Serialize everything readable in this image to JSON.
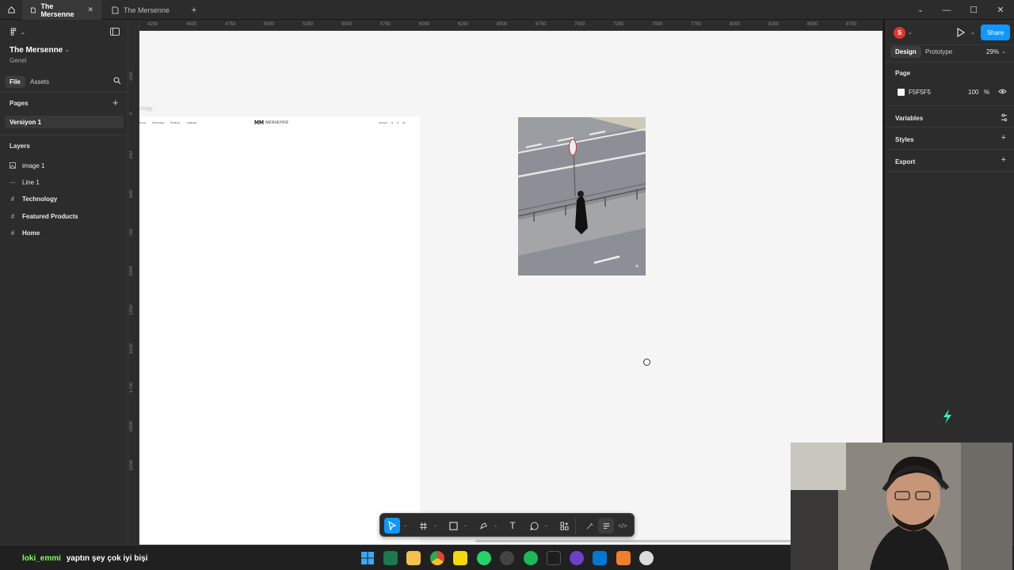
{
  "tabs": [
    {
      "label": "The Mersenne",
      "active": true
    },
    {
      "label": "The Mersenne",
      "active": false
    }
  ],
  "left_panel": {
    "project_name": "The Mersenne",
    "team": "Genel",
    "tab_file": "File",
    "tab_assets": "Assets",
    "pages_title": "Pages",
    "pages": [
      "Versiyon 1"
    ],
    "layers_title": "Layers",
    "layers": [
      {
        "label": "image 1",
        "icon": "image-icon"
      },
      {
        "label": "Line 1",
        "icon": "line-icon"
      },
      {
        "label": "Technology",
        "icon": "frame-icon"
      },
      {
        "label": "Featured Products",
        "icon": "frame-icon"
      },
      {
        "label": "Home",
        "icon": "frame-icon"
      }
    ]
  },
  "ruler_top": [
    "4250",
    "4500",
    "4750",
    "5000",
    "5250",
    "5500",
    "5750",
    "6000",
    "6250",
    "6500",
    "6750",
    "7000",
    "7250",
    "7500",
    "7750",
    "8000",
    "8250",
    "8500",
    "8750"
  ],
  "ruler_left": [
    "-250",
    "0",
    "250",
    "500",
    "750",
    "1000",
    "1250",
    "1500",
    "1750",
    "2000",
    "2250"
  ],
  "canvas": {
    "frame_label": "ology",
    "frame_logo": "MERSENNE",
    "frame_nav": [
      "Home",
      "Technology",
      "Products",
      "Lookbook"
    ],
    "frame_nav_right": [
      "Account",
      "Q",
      "A",
      "W"
    ],
    "background": "#F5F5F5"
  },
  "right_panel": {
    "avatar_letter": "S",
    "share_label": "Share",
    "tab_design": "Design",
    "tab_prototype": "Prototype",
    "zoom": "29%",
    "page_section": "Page",
    "page_color_hex": "F5F5F5",
    "page_opacity": "100",
    "page_opacity_unit": "%",
    "variables_label": "Variables",
    "styles_label": "Styles",
    "export_label": "Export",
    "accent": "#0d99ff"
  },
  "chat": {
    "user": "loki_emmi",
    "message": "yaptın şey çok iyi bişi",
    "user_color": "#7fff5a"
  }
}
